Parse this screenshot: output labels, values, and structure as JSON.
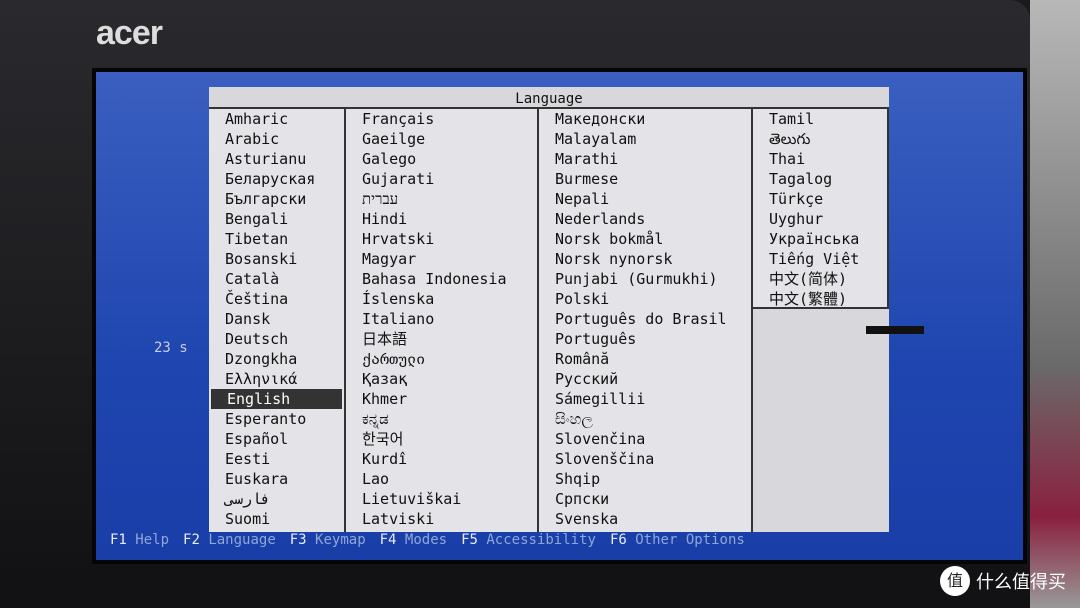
{
  "device": {
    "brand_logo": "acer"
  },
  "menu": {
    "title": "Language",
    "columns": [
      [
        "Amharic",
        "Arabic",
        "Asturianu",
        "Беларуская",
        "Български",
        "Bengali",
        "Tibetan",
        "Bosanski",
        "Català",
        "Čeština",
        "Dansk",
        "Deutsch",
        "Dzongkha",
        "Ελληνικά",
        "English",
        "Esperanto",
        "Español",
        "Eesti",
        "Euskara",
        "فارسی",
        "Suomi"
      ],
      [
        "Français",
        "Gaeilge",
        "Galego",
        "Gujarati",
        "עברית",
        "Hindi",
        "Hrvatski",
        "Magyar",
        "Bahasa Indonesia",
        "Íslenska",
        "Italiano",
        "日本語",
        "ქართული",
        "Қазақ",
        "Khmer",
        "ಕನ್ನಡ",
        "한국어",
        "Kurdî",
        "Lao",
        "Lietuviškai",
        "Latviski"
      ],
      [
        "Македонски",
        "Malayalam",
        "Marathi",
        "Burmese",
        "Nepali",
        "Nederlands",
        "Norsk bokmål",
        "Norsk nynorsk",
        "Punjabi (Gurmukhi)",
        "Polski",
        "Português do Brasil",
        "Português",
        "Română",
        "Русский",
        "Sámegillii",
        "සිංහල",
        "Slovenčina",
        "Slovenščina",
        "Shqip",
        "Српски",
        "Svenska"
      ],
      [
        "Tamil",
        "తెలుగు",
        "Thai",
        "Tagalog",
        "Türkçe",
        "Uyghur",
        "Українська",
        "Tiếng Việt",
        "中文(简体)",
        "中文(繁體)"
      ]
    ],
    "selected": "English"
  },
  "timer": "23 s",
  "function_keys": [
    {
      "key": "F1",
      "label": "Help"
    },
    {
      "key": "F2",
      "label": "Language"
    },
    {
      "key": "F3",
      "label": "Keymap"
    },
    {
      "key": "F4",
      "label": "Modes"
    },
    {
      "key": "F5",
      "label": "Accessibility"
    },
    {
      "key": "F6",
      "label": "Other Options"
    }
  ],
  "watermark": {
    "icon": "值",
    "text": "什么值得买"
  }
}
